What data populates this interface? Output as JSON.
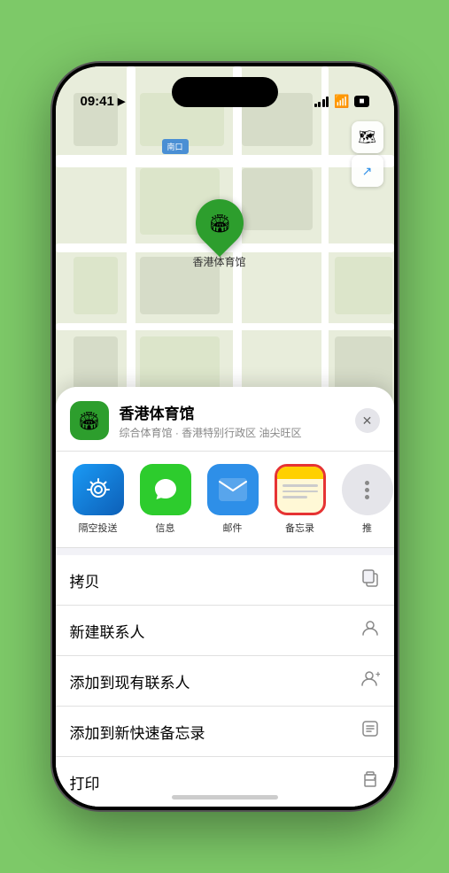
{
  "status_bar": {
    "time": "09:41",
    "location_icon": "▶"
  },
  "map": {
    "label": "南口",
    "marker_label": "香港体育馆",
    "marker_emoji": "🏟"
  },
  "map_controls": {
    "map_icon": "🗺",
    "location_icon": "⬆"
  },
  "location_card": {
    "name": "香港体育馆",
    "subtitle": "综合体育馆 · 香港特别行政区 油尖旺区",
    "close": "✕"
  },
  "share_items": [
    {
      "id": "airdrop",
      "label": "隔空投送",
      "type": "airdrop"
    },
    {
      "id": "messages",
      "label": "信息",
      "type": "messages"
    },
    {
      "id": "mail",
      "label": "邮件",
      "type": "mail"
    },
    {
      "id": "notes",
      "label": "备忘录",
      "type": "notes"
    },
    {
      "id": "more",
      "label": "推",
      "type": "more"
    }
  ],
  "menu_items": [
    {
      "label": "拷贝",
      "icon": "📋"
    },
    {
      "label": "新建联系人",
      "icon": "👤"
    },
    {
      "label": "添加到现有联系人",
      "icon": "👤"
    },
    {
      "label": "添加到新快速备忘录",
      "icon": "🖼"
    },
    {
      "label": "打印",
      "icon": "🖨"
    }
  ]
}
